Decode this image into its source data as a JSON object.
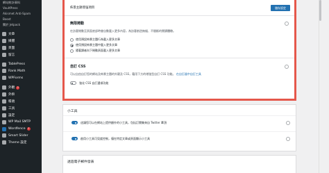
{
  "sidebar": {
    "top_items": [
      "網站統計資料",
      "VaultPress",
      "Akismet Anti-Spam",
      "Boost",
      "關於 Jetpack"
    ],
    "items": [
      {
        "label": "文章",
        "icon": "pin-icon"
      },
      {
        "label": "媒體",
        "icon": "media-icon"
      },
      {
        "label": "頁面",
        "icon": "page-icon"
      },
      {
        "label": "留言",
        "icon": "comment-icon"
      },
      {
        "label": "TablePress",
        "icon": "table-icon"
      },
      {
        "label": "Rank Math",
        "icon": "chart-icon"
      },
      {
        "label": "WPForms",
        "icon": "form-icon"
      },
      {
        "label": "外觀",
        "icon": "brush-icon",
        "badge": "2"
      },
      {
        "label": "外掛",
        "icon": "plugin-icon"
      },
      {
        "label": "帳號",
        "icon": "user-icon"
      },
      {
        "label": "工具",
        "icon": "wrench-icon"
      },
      {
        "label": "設定",
        "icon": "settings-icon"
      },
      {
        "label": "WP Mail SMTP",
        "icon": "mail-icon"
      },
      {
        "label": "Wordfence",
        "icon": "shield-icon",
        "badge": "2"
      },
      {
        "label": "Smart Slider",
        "icon": "slider-icon"
      },
      {
        "label": "Theme 設定",
        "icon": "theme-icon"
      }
    ]
  },
  "highlight": {
    "header_title": "佈景主題增強項目",
    "header_button": "儲存設定",
    "infinite_scroll": {
      "title": "無限捲動",
      "desc": "在訪客捲動至頁面底部時會自動載入更多內容，為訪客創造無縫、不間斷的閱讀體驗。",
      "options": [
        {
          "label": "使用預設佈景主題行為載入更多文章",
          "checked": false
        },
        {
          "label": "使用預設佈景主題中載入更多文章",
          "checked": true
        },
        {
          "label": "隨著讀者向下捲動頁面載入更多文章",
          "checked": false
        }
      ]
    },
    "custom_css": {
      "title": "自訂 CSS",
      "desc": "可以自由自訂您的網站及佈景主題的外觀及 CSS，藉用下方的增強型自訂 CSS 功能。",
      "link": "在自訂器中自訂工具",
      "toggle_label": "強化 CSS 自訂選項功能"
    }
  },
  "widgets": {
    "title": "小工具",
    "rows": [
      {
        "label": "這讓您可以在網站上提供額外的小工具，包括訂閱集來自 Twitter 牽頂",
        "on": true
      },
      {
        "label": "啟用小工具可見度控制，僅在特定文章或頁面顯示小工具",
        "on": true
      }
    ]
  },
  "email_panel": {
    "title": "透過電子郵件發表"
  }
}
